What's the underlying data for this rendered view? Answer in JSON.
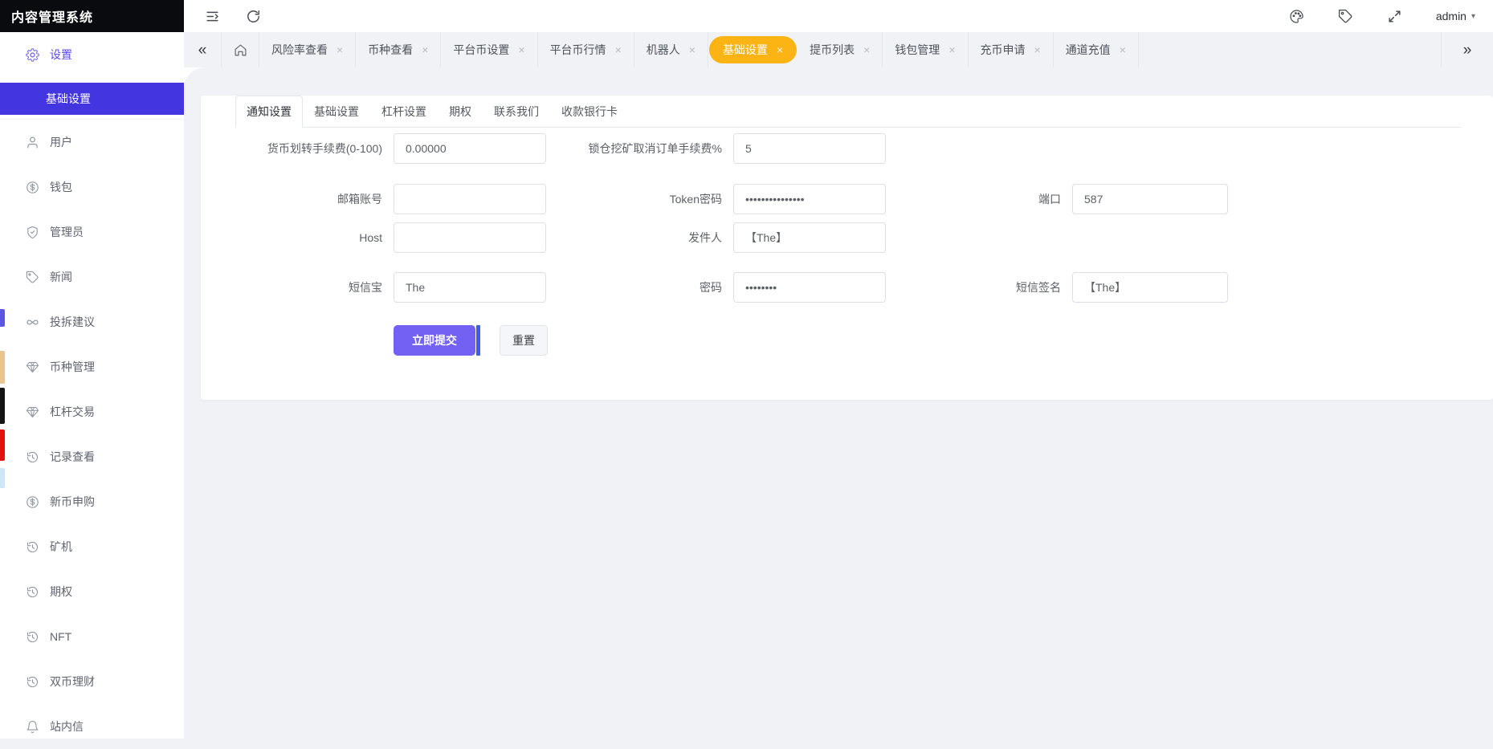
{
  "colors": {
    "sidebar_active_bg": "#4336e0",
    "nav_active_bg": "#fcb415",
    "submit_bg": "#7261f2",
    "submit_edge": "#3d5af1"
  },
  "glyphs": {
    "close": "×",
    "collapse_left": "«",
    "more_right": "»",
    "caret_down": "▾"
  },
  "app": {
    "title": "内容管理系统"
  },
  "topbar": {
    "user": "admin"
  },
  "nav": {
    "tabs": [
      {
        "label": "风险率查看",
        "active": false
      },
      {
        "label": "币种查看",
        "active": false
      },
      {
        "label": "平台币设置",
        "active": false
      },
      {
        "label": "平台币行情",
        "active": false
      },
      {
        "label": "机器人",
        "active": false
      },
      {
        "label": "基础设置",
        "active": true
      },
      {
        "label": "提币列表",
        "active": false
      },
      {
        "label": "钱包管理",
        "active": false
      },
      {
        "label": "充币申请",
        "active": false
      },
      {
        "label": "通道充值",
        "active": false
      }
    ]
  },
  "sidebar": {
    "parent": {
      "label": "设置"
    },
    "active_sub": {
      "label": "基础设置"
    },
    "items": [
      {
        "label": "用户",
        "icon": "user-icon"
      },
      {
        "label": "钱包",
        "icon": "coin-icon"
      },
      {
        "label": "管理员",
        "icon": "shield-check-icon"
      },
      {
        "label": "新闻",
        "icon": "tag-icon"
      },
      {
        "label": "投拆建议",
        "icon": "infinity-icon"
      },
      {
        "label": "币种管理",
        "icon": "gem-icon"
      },
      {
        "label": "杠杆交易",
        "icon": "gem-icon"
      },
      {
        "label": "记录查看",
        "icon": "history-icon"
      },
      {
        "label": "新币申购",
        "icon": "coin-icon"
      },
      {
        "label": "矿机",
        "icon": "history-icon"
      },
      {
        "label": "期权",
        "icon": "history-icon"
      },
      {
        "label": "NFT",
        "icon": "history-icon"
      },
      {
        "label": "双币理财",
        "icon": "history-icon"
      },
      {
        "label": "站内信",
        "icon": "bell-icon"
      }
    ]
  },
  "card": {
    "tabs": [
      {
        "label": "通知设置",
        "active": true
      },
      {
        "label": "基础设置",
        "active": false
      },
      {
        "label": "杠杆设置",
        "active": false
      },
      {
        "label": "期权",
        "active": false
      },
      {
        "label": "联系我们",
        "active": false
      },
      {
        "label": "收款银行卡",
        "active": false
      }
    ],
    "form": {
      "fields": {
        "transfer_fee": {
          "label": "货币划转手续费(0-100)",
          "value": "0.00000"
        },
        "mining_cancel_fee": {
          "label": "锁仓挖矿取消订单手续费%",
          "value": "5"
        },
        "email_account": {
          "label": "邮箱账号",
          "value": ""
        },
        "token_password": {
          "label": "Token密码",
          "value": "•••••••••••••••"
        },
        "port": {
          "label": "端口",
          "value": "587"
        },
        "host": {
          "label": "Host",
          "value": ""
        },
        "sender": {
          "label": "发件人",
          "value": "【The】"
        },
        "sms_bao": {
          "label": "短信宝",
          "value": "The"
        },
        "password": {
          "label": "密码",
          "value": "••••••••"
        },
        "sms_signature": {
          "label": "短信签名",
          "value": "【The】"
        }
      },
      "submit_label": "立即提交",
      "reset_label": "重置"
    }
  },
  "edge_blocks": [
    {
      "color": "#5c55e8"
    },
    {
      "color": "#eac492"
    },
    {
      "color": "#141414"
    },
    {
      "color": "#e31212"
    },
    {
      "color": "#cfe6f8"
    }
  ]
}
